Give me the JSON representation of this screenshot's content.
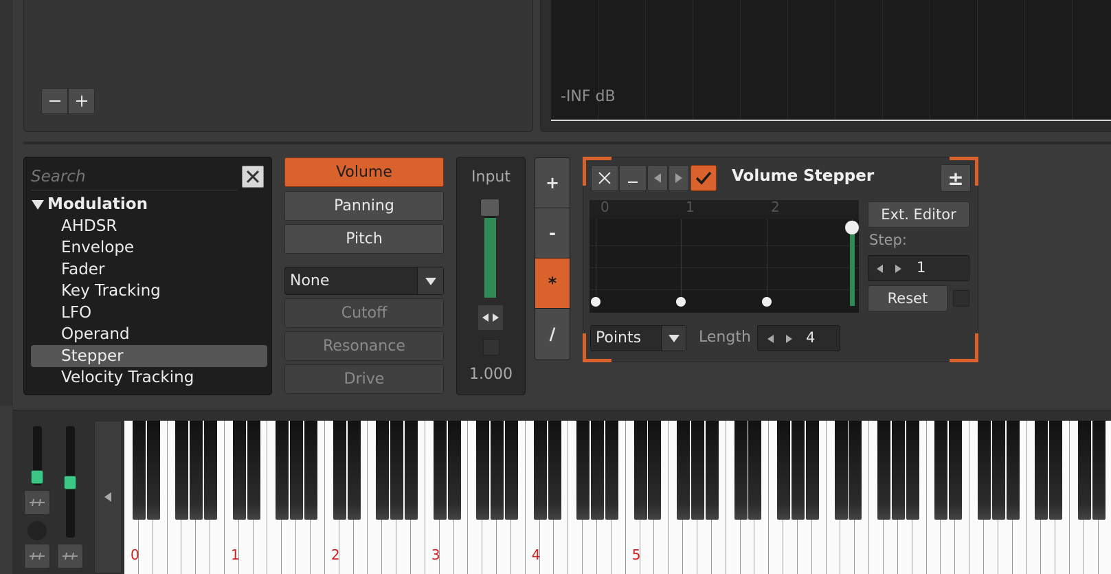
{
  "top": {
    "level_label": "-INF dB"
  },
  "browser": {
    "search_placeholder": "Search",
    "category": "Modulation",
    "items": [
      "AHDSR",
      "Envelope",
      "Fader",
      "Key Tracking",
      "LFO",
      "Operand",
      "Stepper",
      "Velocity Tracking"
    ],
    "selected": "Stepper"
  },
  "targets": {
    "volume": "Volume",
    "panning": "Panning",
    "pitch": "Pitch",
    "filter_select": "None",
    "cutoff": "Cutoff",
    "resonance": "Resonance",
    "drive": "Drive"
  },
  "input": {
    "label": "Input",
    "value_text": "1.000",
    "level": 1.0
  },
  "operators": {
    "plus": "+",
    "minus": "-",
    "multiply": "*",
    "divide": "/",
    "active": "*"
  },
  "stepper": {
    "title": "Volume Stepper",
    "plus_minus": "±",
    "ext_editor": "Ext. Editor",
    "step_label": "Step:",
    "step_value": "1",
    "reset": "Reset",
    "mode_select": "Points",
    "length_label": "Length",
    "length_value": "4",
    "ruler": [
      "0",
      "1",
      "2"
    ],
    "step_values": [
      0,
      0,
      0,
      0.9
    ]
  },
  "keyboard": {
    "octave_labels": [
      "0",
      "1",
      "2",
      "3",
      "4",
      "5"
    ]
  },
  "colors": {
    "accent": "#d9622d",
    "meter": "#2f8a55",
    "slider_knob": "#3cc786",
    "octave_label": "#d02020"
  }
}
